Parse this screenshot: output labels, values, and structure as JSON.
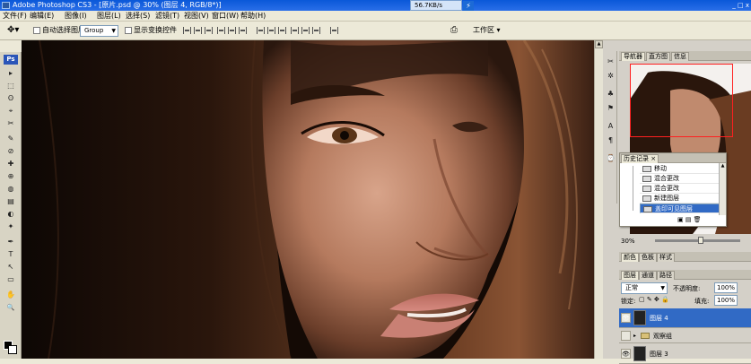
{
  "titlebar": {
    "title": "Adobe Photoshop CS3 - [原片.psd @ 30% (图层 4, RGB/8*)]",
    "net_speed": "56.7KB/s",
    "controls": "_ □ x"
  },
  "menu": [
    "文件(F)",
    "编辑(E)",
    "图像(I)",
    "图层(L)",
    "选择(S)",
    "滤镜(T)",
    "视图(V)",
    "窗口(W)",
    "帮助(H)"
  ],
  "options": {
    "auto_select_label": "自动选择图层",
    "auto_select_value": "Group",
    "transform_label": "显示变换控件",
    "workspace_label": "工作区"
  },
  "tools": [
    "▸",
    "⬚",
    "ʘ",
    "⌖",
    "✂",
    "✎",
    "⊘",
    "✚",
    "⊕",
    "◍",
    "▤",
    "◐",
    "✦",
    "✒",
    "T",
    "↖",
    "▭",
    "✋",
    "🔍"
  ],
  "navigator": {
    "tabs": [
      "导航器",
      "直方图",
      "信息"
    ],
    "zoom": "30%"
  },
  "history": {
    "tab": "历史记录",
    "items": [
      "移动",
      "混合更改",
      "混合更改",
      "新建图层",
      "盖印可见图层"
    ]
  },
  "swatches": {
    "tabs": [
      "颜色",
      "色板",
      "样式"
    ]
  },
  "layers": {
    "tabs": [
      "图层",
      "通道",
      "路径"
    ],
    "blend_mode": "正常",
    "opacity_label": "不透明度:",
    "opacity_value": "100%",
    "lock_label": "锁定:",
    "fill_label": "填充:",
    "fill_value": "100%",
    "rows": [
      "图层 4",
      "观察组",
      "图层 3"
    ]
  },
  "colors": {
    "title_bar": "#0a58d8",
    "selection": "#316ac5"
  }
}
